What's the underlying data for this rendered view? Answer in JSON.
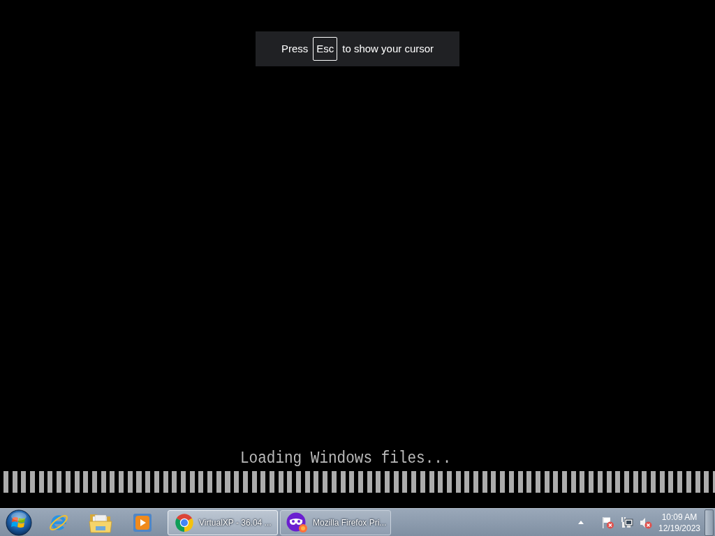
{
  "hint": {
    "parts": [
      {
        "kind": "text",
        "text": "Press"
      },
      {
        "kind": "key",
        "text": "Esc"
      },
      {
        "kind": "text",
        "text": "to show your cursor"
      }
    ]
  },
  "boot_screen": {
    "message": "Loading Windows files...",
    "progress": {
      "level": 1
    }
  },
  "taskbar": {
    "tasks": [
      {
        "kind": "ring",
        "title": "VirtualXP - 36.04 ...",
        "selected": true
      },
      {
        "kind": "mask",
        "title": "Mozilla Firefox Pri...",
        "selected": false
      }
    ],
    "clock": {
      "time": "10:09 AM",
      "date": "12/19/2023"
    }
  }
}
